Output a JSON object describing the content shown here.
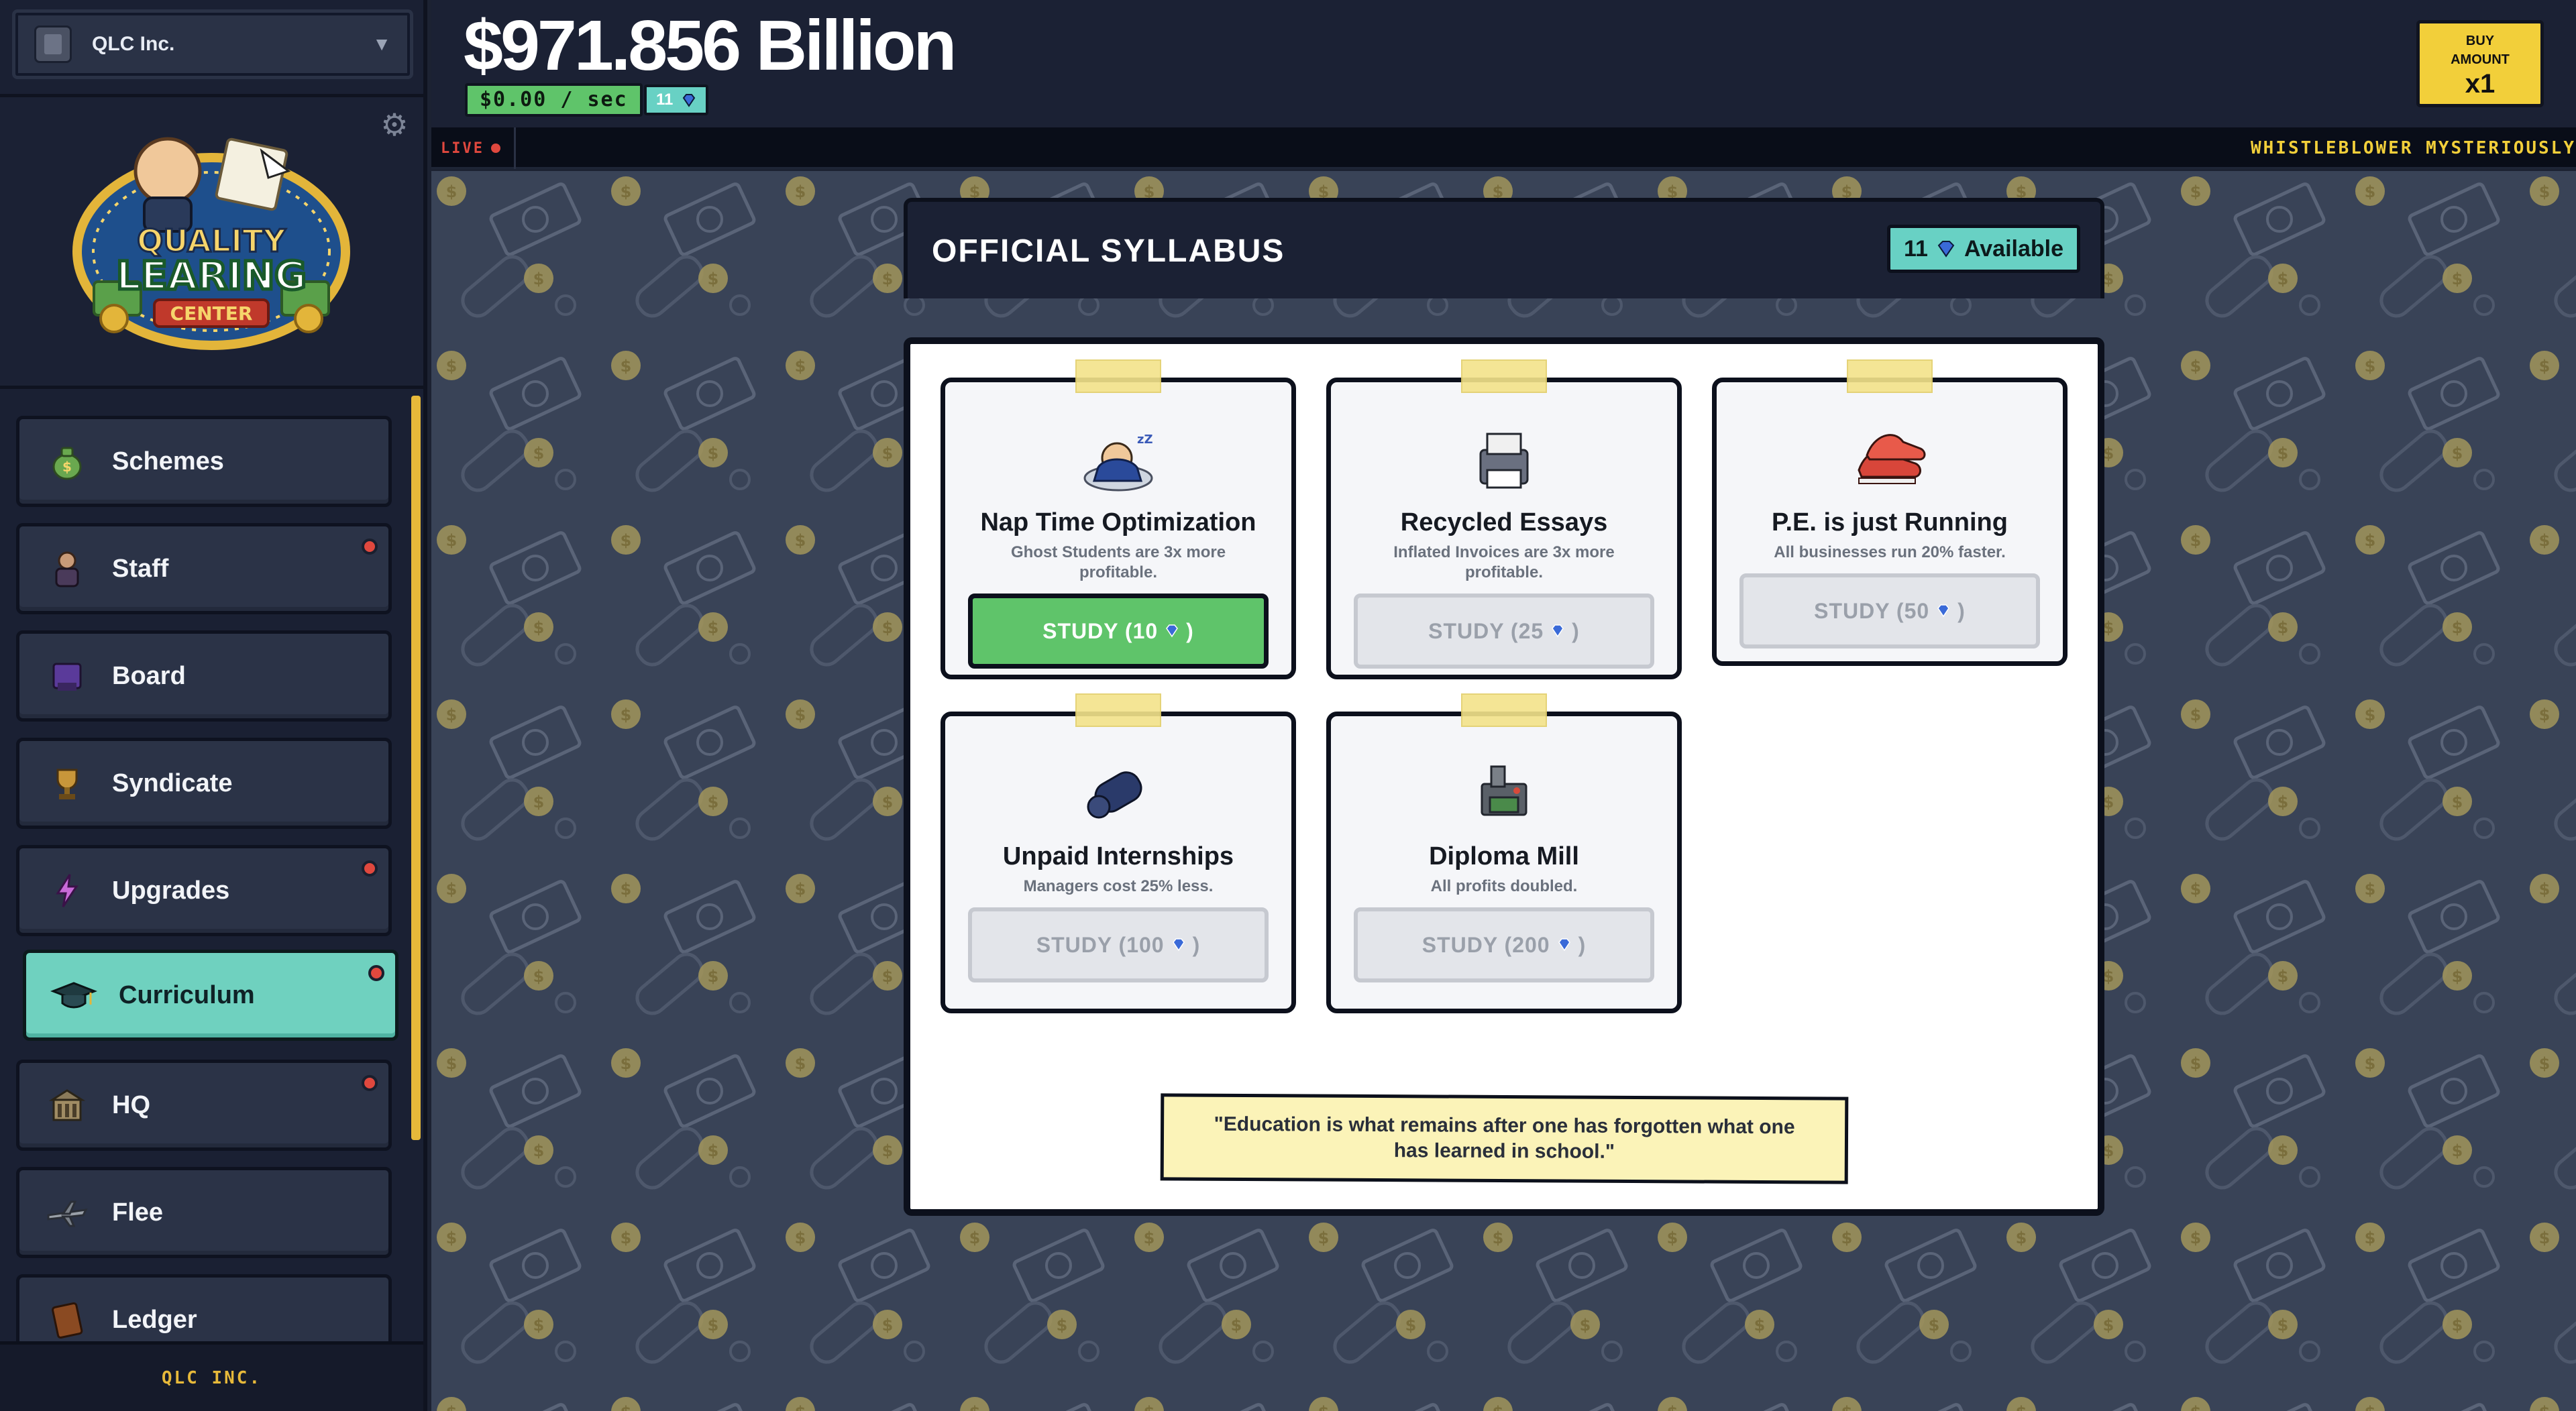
{
  "company": {
    "name": "QLC Inc.",
    "caret": "▼"
  },
  "logo": {
    "line1": "QUALITY",
    "line2": "LEARING",
    "line3": "CENTER"
  },
  "nav": {
    "items": [
      {
        "label": "Schemes",
        "icon": "money-bag-icon",
        "badge": false
      },
      {
        "label": "Staff",
        "icon": "worker-icon",
        "badge": true
      },
      {
        "label": "Board",
        "icon": "boardroom-icon",
        "badge": false
      },
      {
        "label": "Syndicate",
        "icon": "trophy-icon",
        "badge": false
      },
      {
        "label": "Upgrades",
        "icon": "lightning-icon",
        "badge": true
      },
      {
        "label": "Curriculum",
        "icon": "graduation-cap-icon",
        "badge": true,
        "active": true
      },
      {
        "label": "HQ",
        "icon": "building-icon",
        "badge": true
      },
      {
        "label": "Flee",
        "icon": "airplane-icon",
        "badge": false
      },
      {
        "label": "Ledger",
        "icon": "ledger-book-icon",
        "badge": false
      }
    ],
    "footer": "QLC INC."
  },
  "header": {
    "balance": "$971.856 Billion",
    "rate": "$0.00 / sec",
    "gems": "11",
    "buy_amount": {
      "label_line1": "BUY",
      "label_line2": "AMOUNT",
      "value": "x1"
    }
  },
  "ticker": {
    "live": "LIVE",
    "text": "WHISTLEBLOWER MYSTERIOUSLY"
  },
  "syllabus": {
    "title": "OFFICIAL SYLLABUS",
    "available_count": "11",
    "available_label": "Available",
    "cards": [
      {
        "title": "Nap Time Optimization",
        "desc": "Ghost Students are 3x more profitable.",
        "button": "STUDY (10",
        "state": "enabled",
        "icon": "sleeping-student-icon"
      },
      {
        "title": "Recycled Essays",
        "desc": "Inflated Invoices are 3x more profitable.",
        "button": "STUDY (25",
        "state": "disabled",
        "icon": "printer-icon"
      },
      {
        "title": "P.E. is just Running",
        "desc": "All businesses run 20% faster.",
        "button": "STUDY (50",
        "state": "disabled",
        "icon": "sneakers-icon"
      },
      {
        "title": "Unpaid Internships",
        "desc": "Managers cost 25% less.",
        "button": "STUDY (100",
        "state": "disabled",
        "icon": "rolled-diploma-icon"
      },
      {
        "title": "Diploma Mill",
        "desc": "All profits doubled.",
        "button": "STUDY (200",
        "state": "disabled",
        "icon": "diploma-machine-icon"
      }
    ],
    "close_paren": ")"
  },
  "quote": "\"Education is what remains after one has forgotten what one has learned in school.\"",
  "colors": {
    "accent_teal": "#6fd1bf",
    "gold": "#f2cf3a",
    "green": "#5fc46a",
    "alert": "#e0483e"
  }
}
